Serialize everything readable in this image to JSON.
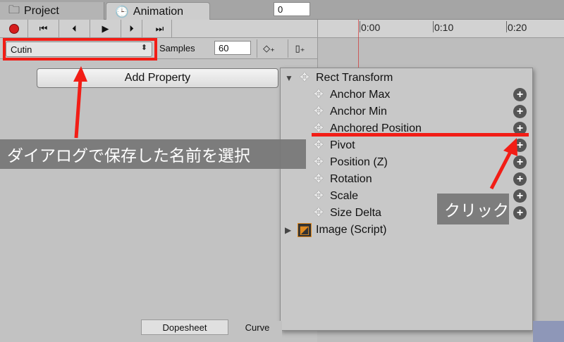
{
  "tabs": {
    "project": "Project",
    "animation": "Animation"
  },
  "toolbar": {
    "frame_value": "0"
  },
  "timeline": {
    "labels": [
      "0:00",
      "0:10",
      "0:20"
    ]
  },
  "clip": {
    "selected": "Cutin",
    "samples_label": "Samples",
    "samples_value": "60"
  },
  "add_property_label": "Add Property",
  "popup": {
    "root": "Rect Transform",
    "children": [
      "Anchor Max",
      "Anchor Min",
      "Anchored Position",
      "Pivot",
      "Position (Z)",
      "Rotation",
      "Scale",
      "Size Delta"
    ],
    "image_script": "Image (Script)"
  },
  "bottom_tabs": {
    "dopesheet": "Dopesheet",
    "curves": "Curve"
  },
  "annotations": {
    "select_note": "ダイアログで保存した名前を選択",
    "click_note": "クリック"
  },
  "colors": {
    "annotation_red": "#f21d16",
    "record_red": "#d61c1c"
  }
}
